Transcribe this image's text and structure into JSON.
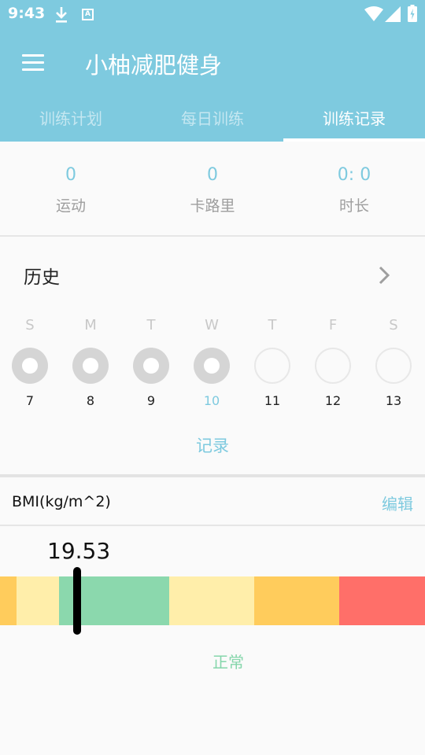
{
  "status_bar": {
    "time": "9:43",
    "app_badge": "A"
  },
  "app": {
    "title": "小柚减肥健身"
  },
  "tabs": [
    {
      "label": "训练计划",
      "active": false
    },
    {
      "label": "每日训练",
      "active": false
    },
    {
      "label": "训练记录",
      "active": true
    }
  ],
  "stats": [
    {
      "value": "0",
      "label": "运动"
    },
    {
      "value": "0",
      "label": "卡路里"
    },
    {
      "value": "0: 0",
      "label": "时长"
    }
  ],
  "history": {
    "title": "历史",
    "days": [
      {
        "letter": "S",
        "number": "7",
        "done": true,
        "today": false
      },
      {
        "letter": "M",
        "number": "8",
        "done": true,
        "today": false
      },
      {
        "letter": "T",
        "number": "9",
        "done": true,
        "today": false
      },
      {
        "letter": "W",
        "number": "10",
        "done": true,
        "today": true
      },
      {
        "letter": "T",
        "number": "11",
        "done": false,
        "today": false
      },
      {
        "letter": "F",
        "number": "12",
        "done": false,
        "today": false
      },
      {
        "letter": "S",
        "number": "13",
        "done": false,
        "today": false
      }
    ],
    "record_label": "记录"
  },
  "bmi": {
    "title": "BMI(kg/m^2)",
    "edit_label": "编辑",
    "value": "19.53",
    "status": "正常",
    "colors": {
      "underweight_dark": "#ffcc5c",
      "underweight_light": "#ffeeaa",
      "normal": "#8bd8ad",
      "overweight": "#ffeeaa",
      "obese": "#ffcc5c",
      "severe": "#ff6f69"
    }
  },
  "colors": {
    "accent": "#7ecadf"
  }
}
